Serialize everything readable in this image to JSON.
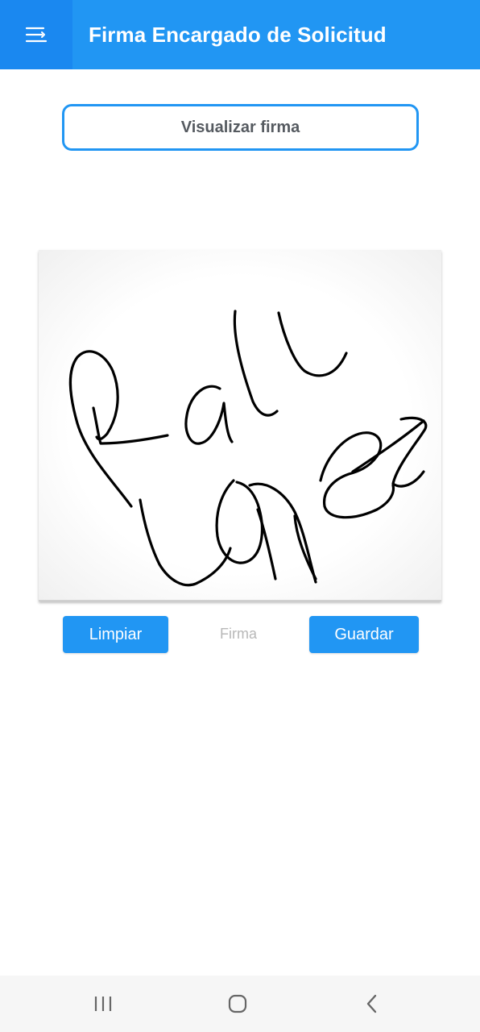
{
  "header": {
    "title": "Firma Encargado de Solicitud",
    "menu_icon": "menu-icon"
  },
  "actions": {
    "visualize_label": "Visualizar firma",
    "clear_label": "Limpiar",
    "save_label": "Guardar"
  },
  "signature_pad": {
    "label": "Firma"
  },
  "navbar": {
    "recents_icon": "recents-icon",
    "home_icon": "home-icon",
    "back_icon": "back-icon"
  },
  "colors": {
    "primary": "#2196f3",
    "primary_dark": "#1a88f0",
    "pad_label": "#b8b8b8",
    "button_text": "#ffffff"
  }
}
